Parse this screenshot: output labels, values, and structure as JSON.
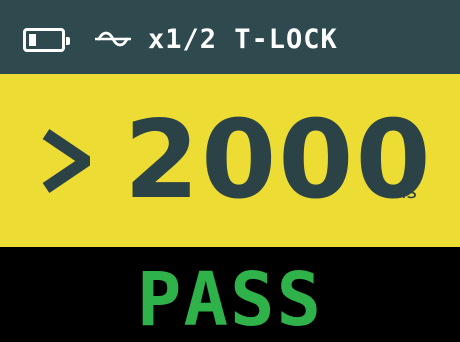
{
  "status_bar": {
    "battery_icon": "battery-low-icon",
    "ac_icon": "ac-sine-wave-icon",
    "mode_text": "x1/2 T-LOCK",
    "background_color": "#2e4a4f",
    "text_color": "#ffffff"
  },
  "reading": {
    "comparator_icon": "greater-than-icon",
    "value": "2000",
    "unit": "ms",
    "background_color": "#eddc34",
    "text_color": "#2b4347"
  },
  "result": {
    "label": "PASS",
    "text_color": "#2fb24a",
    "background_color": "#000000"
  }
}
